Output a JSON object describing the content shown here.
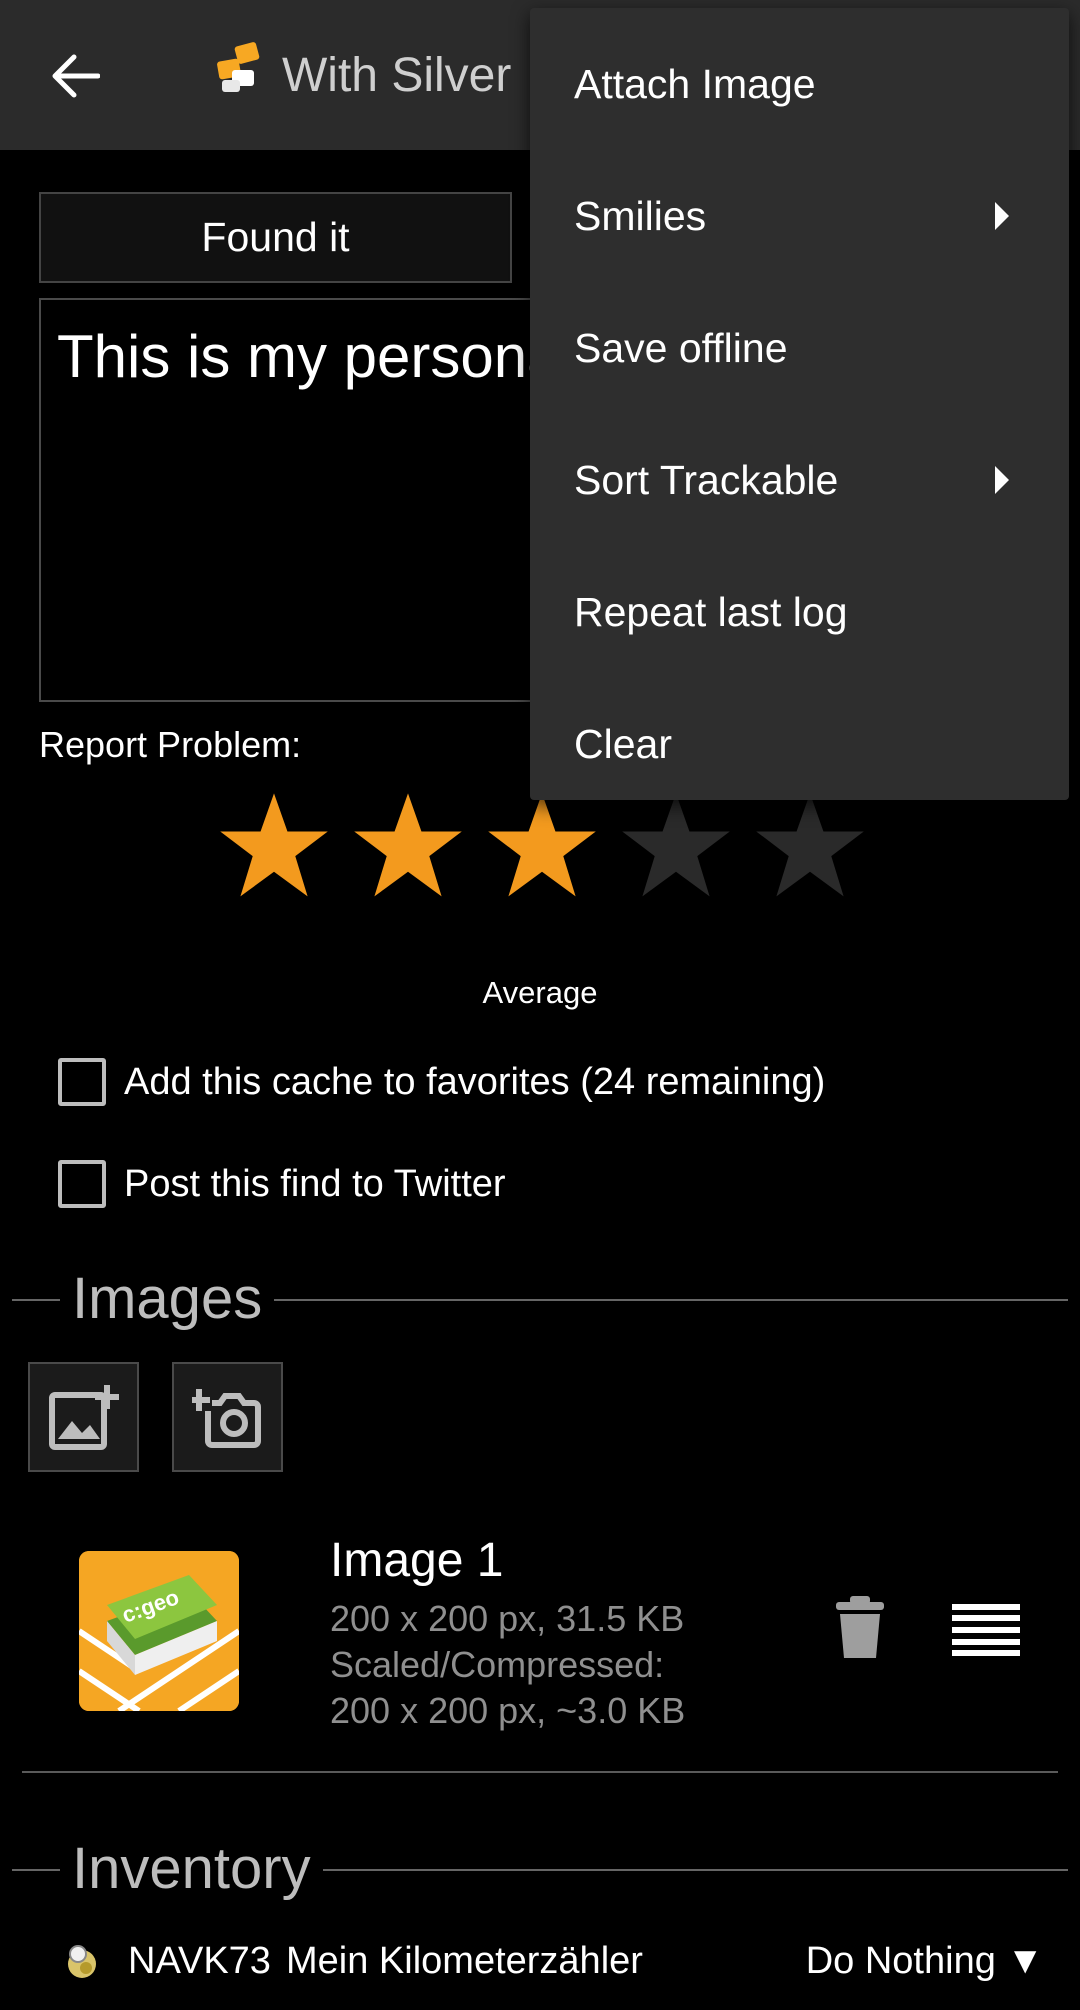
{
  "toolbar": {
    "title": "With Silver",
    "back_icon": "arrow-left-icon",
    "cache_icon": "cache-type-icon"
  },
  "log": {
    "type_label": "Found it",
    "text": "This is my personal log"
  },
  "report_problem": {
    "label": "Report Problem:"
  },
  "rating": {
    "value": 3,
    "max": 5,
    "label": "Average",
    "filled_color": "#f39a1e",
    "empty_color": "#2a2a2a"
  },
  "options": {
    "favorites_label": "Add this cache to favorites (24 remaining)",
    "favorites_checked": false,
    "twitter_label": "Post this find to Twitter",
    "twitter_checked": false
  },
  "images_section": {
    "title": "Images",
    "add_image_icon": "add-photo-icon",
    "camera_icon": "add-camera-icon",
    "items": [
      {
        "name": "Image 1",
        "size_line": "200 x 200 px, 31.5 KB",
        "scaled_line": "Scaled/Compressed:",
        "scaled_size_line": "200 x 200 px, ~3.0 KB",
        "thumb_text": "c:geo"
      }
    ]
  },
  "inventory_section": {
    "title": "Inventory",
    "items": [
      {
        "code": "NAVK73",
        "name": "Mein Kilometerzähler",
        "action": "Do Nothing ▼"
      }
    ]
  },
  "menu": {
    "items": [
      {
        "label": "Attach Image",
        "submenu": false
      },
      {
        "label": "Smilies",
        "submenu": true
      },
      {
        "label": "Save offline",
        "submenu": false
      },
      {
        "label": "Sort Trackable",
        "submenu": true
      },
      {
        "label": "Repeat last log",
        "submenu": false
      },
      {
        "label": "Clear",
        "submenu": false
      }
    ]
  }
}
